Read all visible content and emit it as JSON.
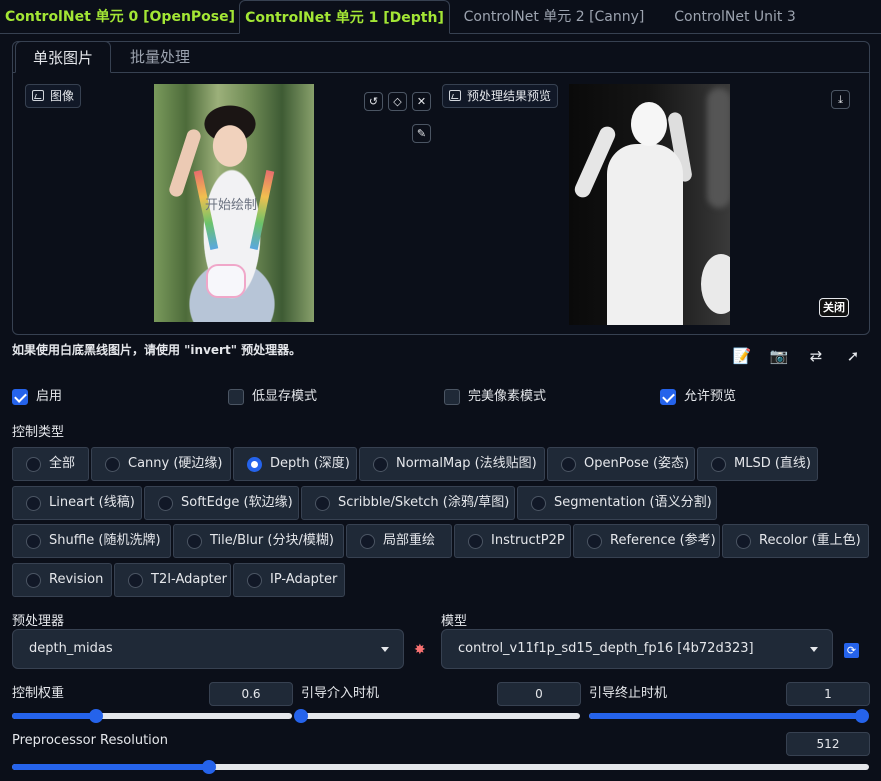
{
  "unit_tabs": [
    {
      "label": "ControlNet 单元 0 [OpenPose]"
    },
    {
      "label": "ControlNet 单元 1 [Depth]"
    },
    {
      "label": "ControlNet 单元 2 [Canny]"
    },
    {
      "label": "ControlNet Unit 3"
    }
  ],
  "image_tabs": [
    {
      "label": "单张图片"
    },
    {
      "label": "批量处理"
    }
  ],
  "image_panel": {
    "input_label": "图像",
    "draw_hint": "开始绘制",
    "preview_label": "预处理结果预览",
    "close_label": "关闭"
  },
  "info_text": "如果使用白底黑线图片，请使用 \"invert\" 预处理器。",
  "tool_icons": [
    "notepad-icon",
    "camera-icon",
    "swap-arrows-icon",
    "send-arrow-icon"
  ],
  "checkboxes": [
    {
      "label": "启用",
      "checked": true
    },
    {
      "label": "低显存模式",
      "checked": false
    },
    {
      "label": "完美像素模式",
      "checked": false
    },
    {
      "label": "允许预览",
      "checked": true
    }
  ],
  "control_type": {
    "label": "控制类型",
    "options": [
      {
        "label": "全部",
        "selected": false
      },
      {
        "label": "Canny (硬边缘)",
        "selected": false
      },
      {
        "label": "Depth (深度)",
        "selected": true
      },
      {
        "label": "NormalMap (法线贴图)",
        "selected": false
      },
      {
        "label": "OpenPose (姿态)",
        "selected": false
      },
      {
        "label": "MLSD (直线)",
        "selected": false
      },
      {
        "label": "Lineart (线稿)",
        "selected": false
      },
      {
        "label": "SoftEdge (软边缘)",
        "selected": false
      },
      {
        "label": "Scribble/Sketch (涂鸦/草图)",
        "selected": false
      },
      {
        "label": "Segmentation (语义分割)",
        "selected": false
      },
      {
        "label": "Shuffle (随机洗牌)",
        "selected": false
      },
      {
        "label": "Tile/Blur (分块/模糊)",
        "selected": false
      },
      {
        "label": "局部重绘",
        "selected": false
      },
      {
        "label": "InstructP2P",
        "selected": false
      },
      {
        "label": "Reference (参考)",
        "selected": false
      },
      {
        "label": "Recolor (重上色)",
        "selected": false
      },
      {
        "label": "Revision",
        "selected": false
      },
      {
        "label": "T2I-Adapter",
        "selected": false
      },
      {
        "label": "IP-Adapter",
        "selected": false
      }
    ]
  },
  "preprocessor": {
    "label": "预处理器",
    "value": "depth_midas"
  },
  "model": {
    "label": "模型",
    "value": "control_v11f1p_sd15_depth_fp16 [4b72d323]"
  },
  "sliders": {
    "weight": {
      "label": "控制权重",
      "value": "0.6",
      "fraction": 0.3
    },
    "start": {
      "label": "引导介入时机",
      "value": "0",
      "fraction": 0.0
    },
    "end": {
      "label": "引导终止时机",
      "value": "1",
      "fraction": 1.0
    },
    "resolution": {
      "label": "Preprocessor Resolution",
      "value": "512",
      "fraction": 0.23
    }
  },
  "colors": {
    "accent": "#2563eb",
    "active_tab": "#a3e635",
    "background": "#0b0f19"
  }
}
